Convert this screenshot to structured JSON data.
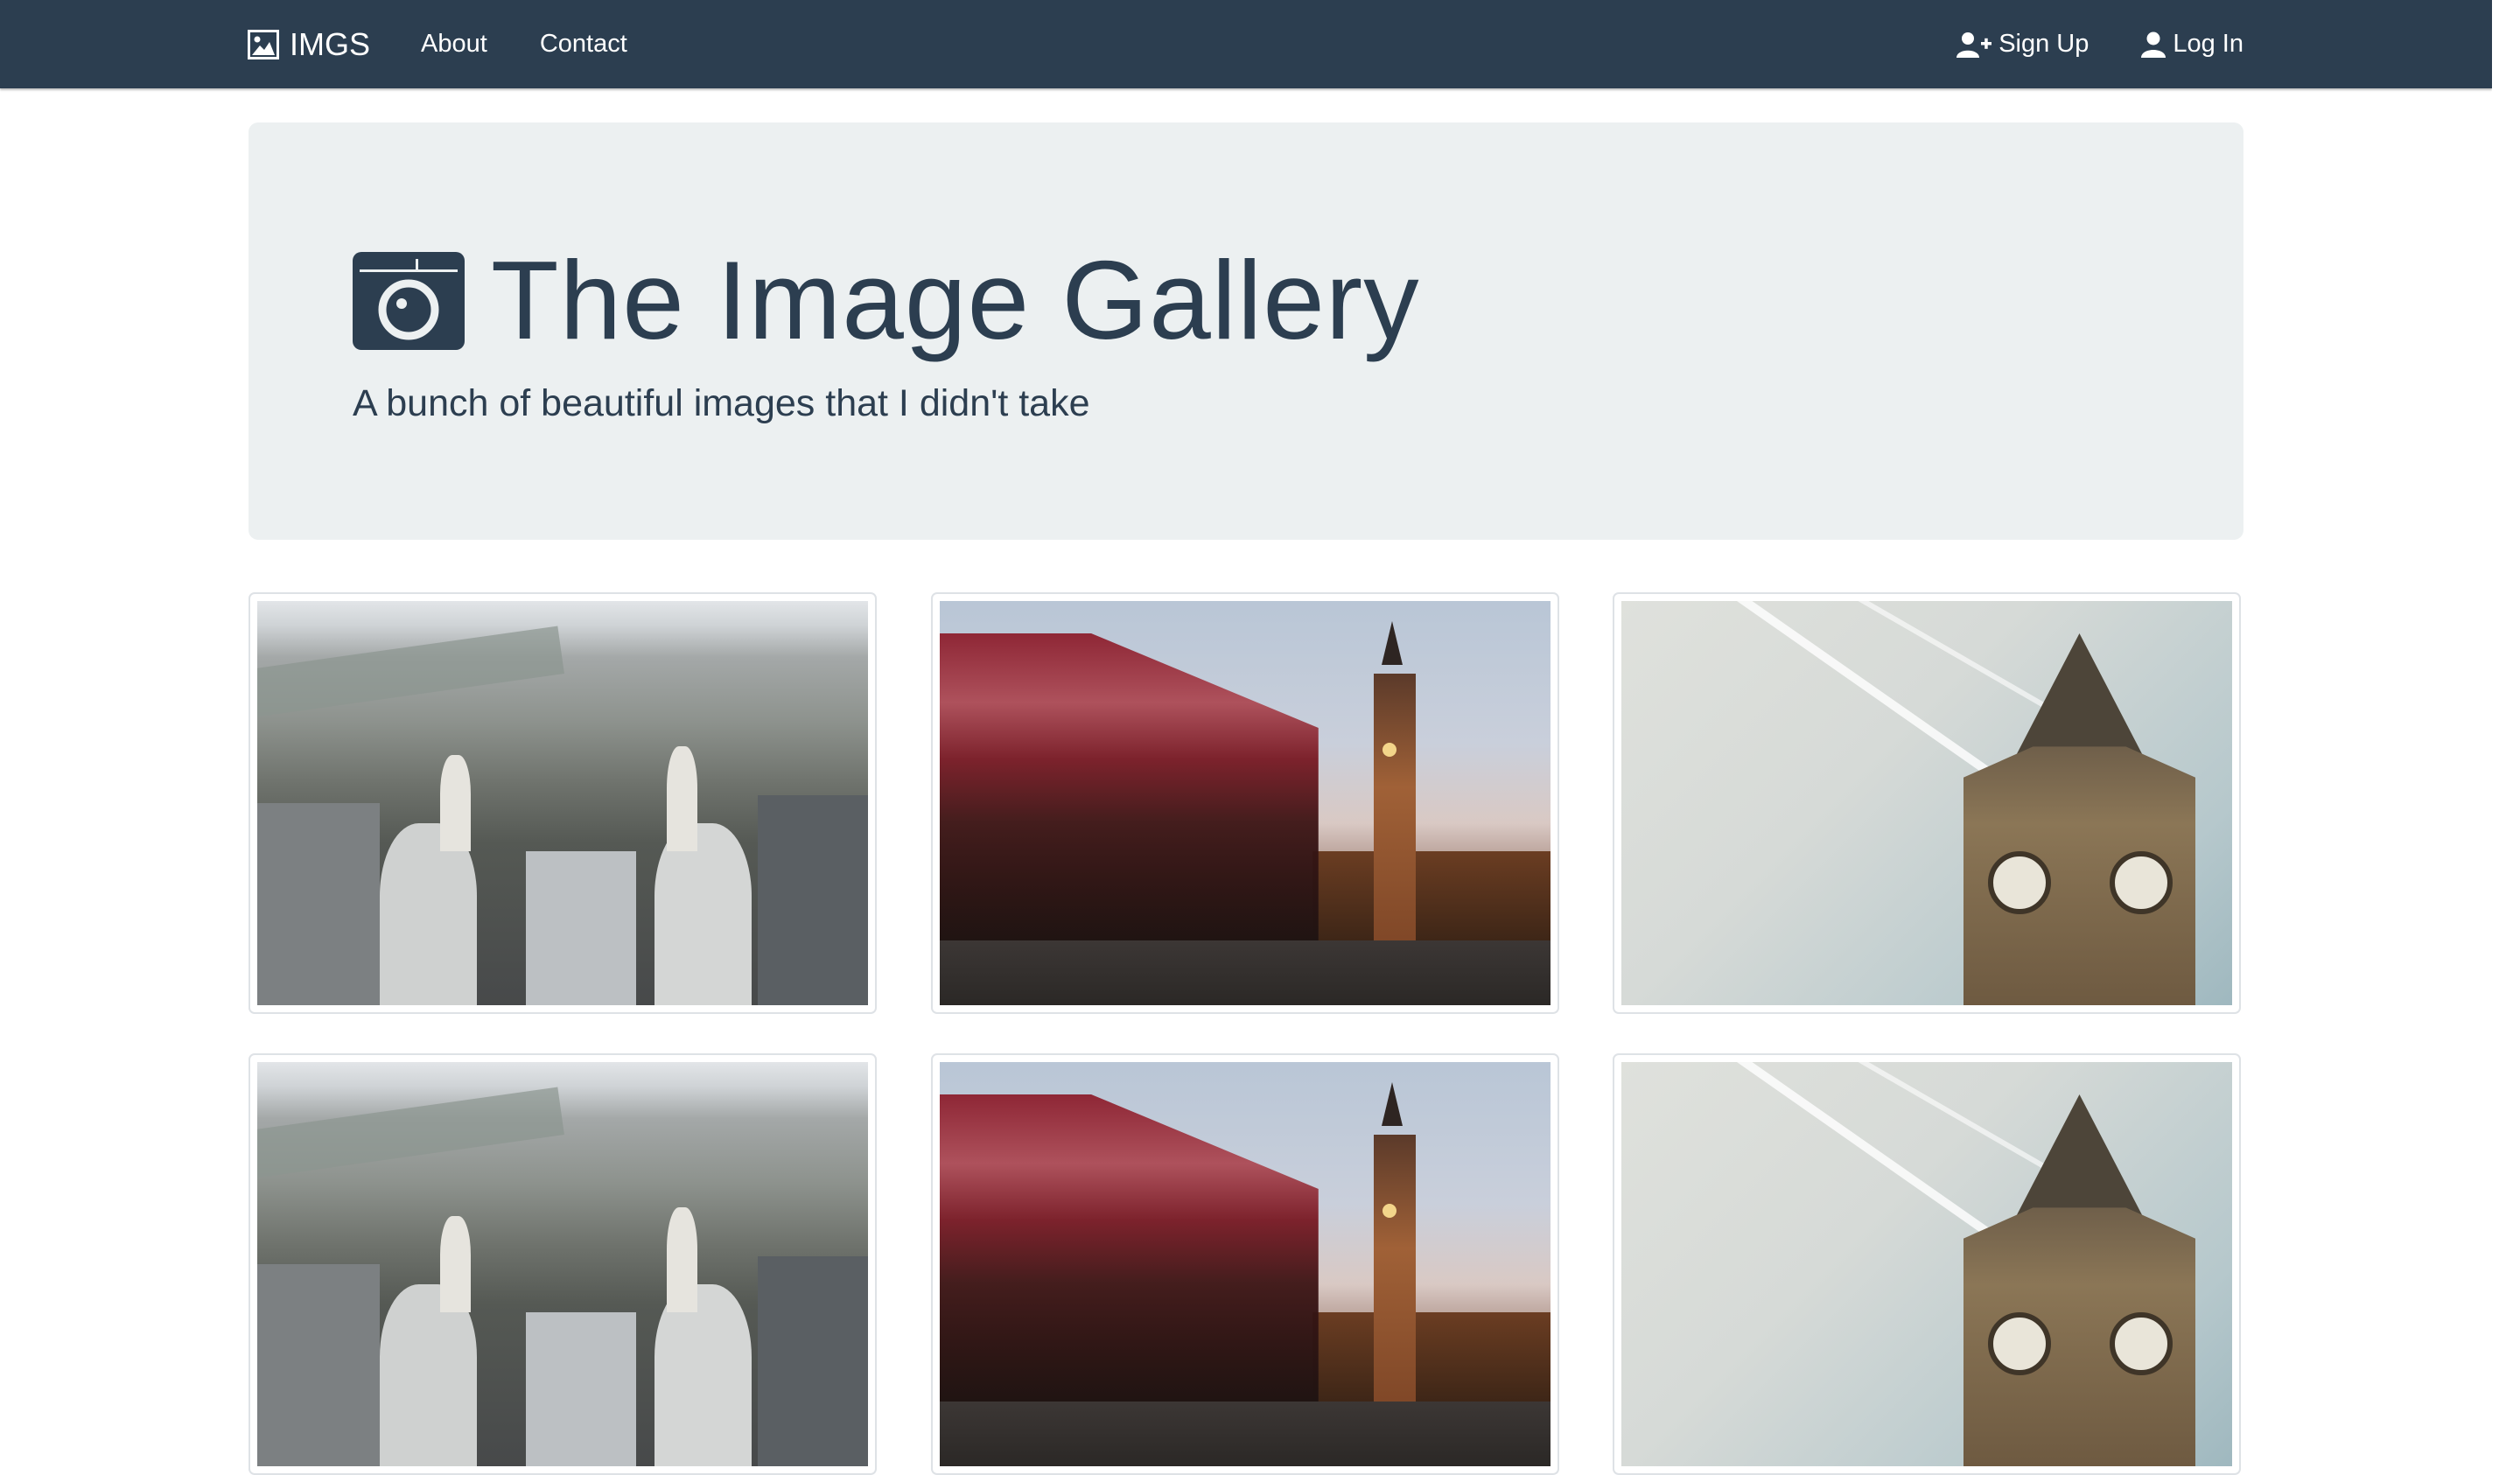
{
  "navbar": {
    "brand": "IMGS",
    "links": [
      "About",
      "Contact"
    ],
    "signup": "Sign Up",
    "login": "Log In",
    "color": "#2c3e50"
  },
  "jumbotron": {
    "title": "The Image Gallery",
    "subtitle": "A bunch of beautiful images that I didn't take",
    "icon": "camera-icon",
    "background": "#ecf0f1"
  },
  "gallery": {
    "images": [
      "london-aerial",
      "bus-big-ben",
      "big-ben-sky",
      "london-aerial",
      "bus-big-ben",
      "big-ben-sky"
    ]
  }
}
